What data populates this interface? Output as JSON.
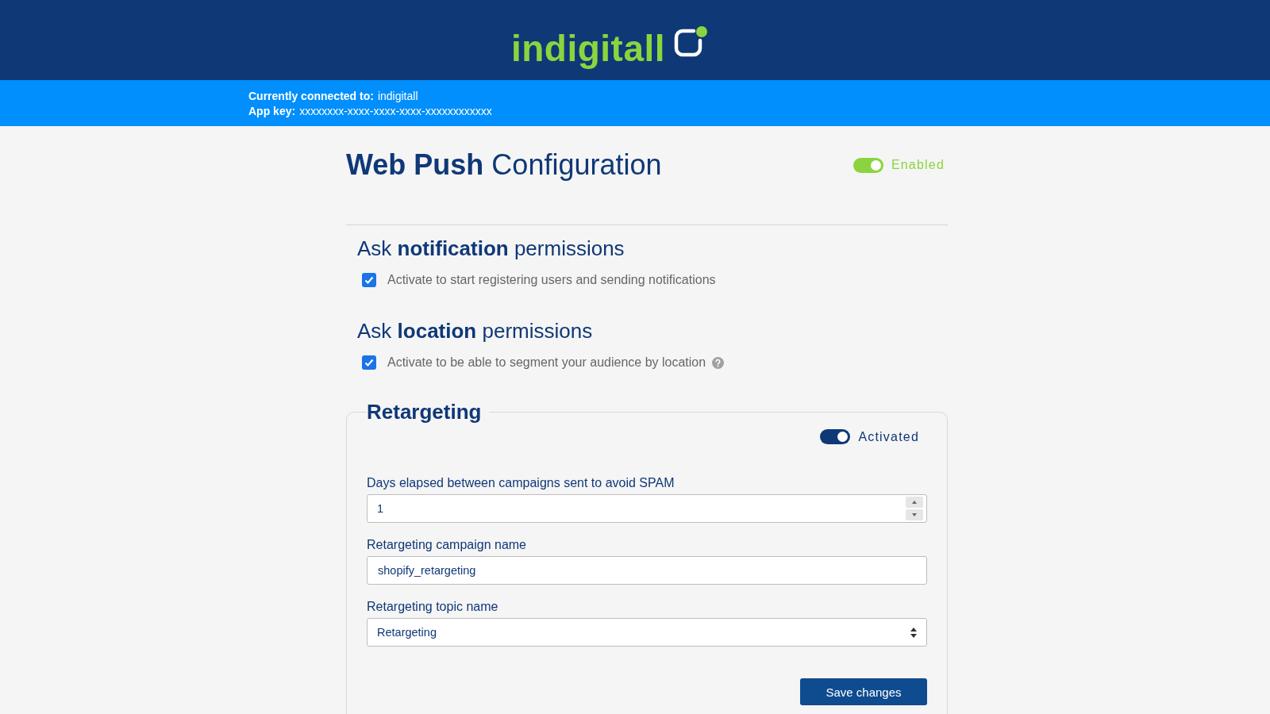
{
  "header": {
    "logo": "indigitall"
  },
  "connection": [
    {
      "label": "Currently connected to:",
      "value": "indigitall"
    },
    {
      "label": "App key:",
      "value": "xxxxxxxx-xxxx-xxxx-xxxx-xxxxxxxxxxxx"
    }
  ],
  "page": {
    "title": "**Web Push** Configuration",
    "toggle": {
      "label": "Enabled",
      "on": true
    }
  },
  "permissions": [
    {
      "heading": "Ask **notification** permissions",
      "label": "Activate to start registering users and sending notifications",
      "checked": true,
      "help": false
    },
    {
      "heading": "Ask **location** permissions",
      "label": "Activate to be able to segment your audience by location",
      "checked": true,
      "help": true
    }
  ],
  "retargeting": {
    "legend": "Retargeting",
    "toggle": {
      "label": "Activated",
      "on": true
    },
    "fields": [
      {
        "kind": "number",
        "label": "Days elapsed between campaigns sent to avoid SPAM",
        "value": "1"
      },
      {
        "kind": "text",
        "label": "Retargeting campaign name",
        "value": "shopify_retargeting"
      },
      {
        "kind": "select",
        "label": "Retargeting topic name",
        "value": "Retargeting"
      }
    ],
    "save_button": "Save changes"
  }
}
